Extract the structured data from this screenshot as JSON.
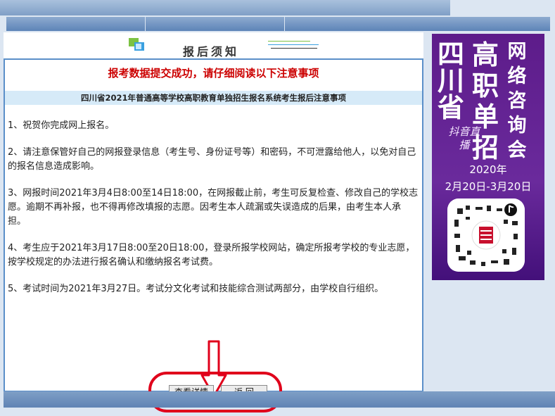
{
  "header": {
    "title": "报后须知"
  },
  "notice": {
    "success_message": "报考数据提交成功，请仔细阅读以下注意事项",
    "subtitle": "四川省2021年普通高等学校高职教育单独招生报名系统考生报后注意事项",
    "items": [
      "1、祝贺你完成网上报名。",
      "2、请注意保管好自己的网报登录信息（考生号、身份证号等）和密码，不可泄露给他人，以免对自己的报名信息造成影响。",
      "3、网报时间2021年3月4日8:00至14日18:00，在网报截止前，考生可反复检查、修改自己的学校志愿。逾期不再补报，也不得再修改填报的志愿。因考生本人疏漏或失误造成的后果，由考生本人承担。",
      "4、考生应于2021年3月17日8:00至20日18:00，登录所报学校网站，确定所报考学校的专业志愿，按学校规定的办法进行报名确认和缴纳报名考试费。",
      "5、考试时间为2021年3月27日。考试分文化考试和技能综合测试两部分，由学校自行组织。"
    ]
  },
  "buttons": {
    "details": "查看详情",
    "back": "返 回"
  },
  "ad": {
    "col_left": "四川省",
    "col_mid": "高职单招",
    "col_right": "网络咨询会",
    "stamp": "抖音直播",
    "year": "2020年",
    "dates": "2月20日-3月20日"
  },
  "colors": {
    "accent_red": "#cc0000",
    "frame_blue": "#5b8fc9",
    "ad_purple": "#5d1c8a"
  }
}
